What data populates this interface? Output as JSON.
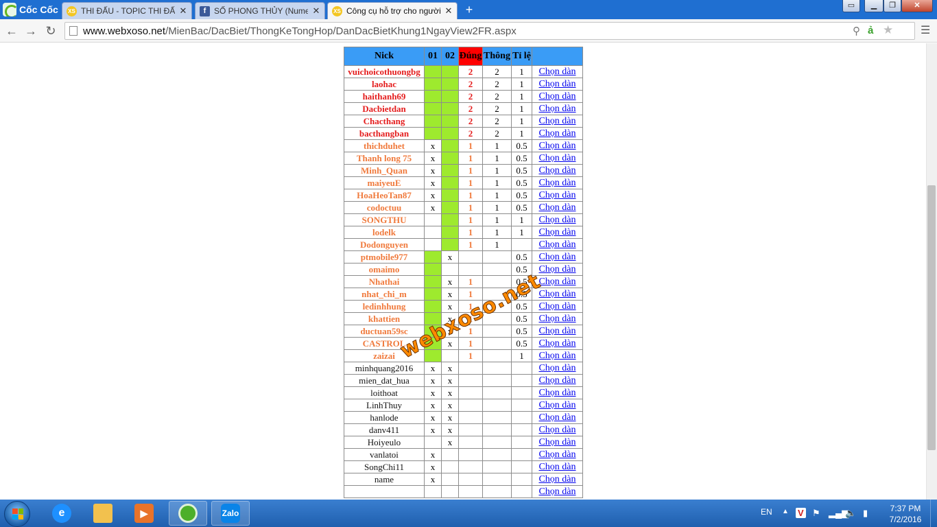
{
  "browser": {
    "brand": "Cốc Cốc",
    "tabs": [
      {
        "title": "THI ĐẤU - TOPIC THI ĐẤU",
        "icon": "xs-icon"
      },
      {
        "title": "SỐ PHONG THỦY (Numero",
        "icon": "facebook-icon"
      },
      {
        "title": "Công cụ hỗ trợ cho người",
        "icon": "xs-icon",
        "active": true
      }
    ],
    "url_host": "www.webxoso.net",
    "url_path": "/MienBac/DacBiet/ThongKeTongHop/DanDacBietKhung1NgayView2FR.aspx"
  },
  "table": {
    "headers": {
      "nick": "Nick",
      "c01": "01",
      "c02": "02",
      "dung": "Đúng",
      "thong": "Thông",
      "tile": "Tỉ lệ",
      "link": ""
    },
    "rows": [
      {
        "nick": "vuichoicothuongbg",
        "c01": "",
        "c02": "",
        "g01": true,
        "g02": true,
        "dung": "2",
        "thong": "2",
        "tile": "1",
        "link": "Chọn dàn",
        "level": 2
      },
      {
        "nick": "laohac",
        "c01": "",
        "c02": "",
        "g01": true,
        "g02": true,
        "dung": "2",
        "thong": "2",
        "tile": "1",
        "link": "Chọn dàn",
        "level": 2
      },
      {
        "nick": "haithanh69",
        "c01": "",
        "c02": "",
        "g01": true,
        "g02": true,
        "dung": "2",
        "thong": "2",
        "tile": "1",
        "link": "Chọn dàn",
        "level": 2
      },
      {
        "nick": "Dacbietdan",
        "c01": "",
        "c02": "",
        "g01": true,
        "g02": true,
        "dung": "2",
        "thong": "2",
        "tile": "1",
        "link": "Chọn dàn",
        "level": 2
      },
      {
        "nick": "Chacthang",
        "c01": "",
        "c02": "",
        "g01": true,
        "g02": true,
        "dung": "2",
        "thong": "2",
        "tile": "1",
        "link": "Chọn dàn",
        "level": 2
      },
      {
        "nick": "bacthangban",
        "c01": "",
        "c02": "",
        "g01": true,
        "g02": true,
        "dung": "2",
        "thong": "2",
        "tile": "1",
        "link": "Chọn dàn",
        "level": 2
      },
      {
        "nick": "thichduhet",
        "c01": "x",
        "c02": "",
        "g01": false,
        "g02": true,
        "dung": "1",
        "thong": "1",
        "tile": "0.5",
        "link": "Chọn dàn",
        "level": 1
      },
      {
        "nick": "Thanh long 75",
        "c01": "x",
        "c02": "",
        "g01": false,
        "g02": true,
        "dung": "1",
        "thong": "1",
        "tile": "0.5",
        "link": "Chọn dàn",
        "level": 1
      },
      {
        "nick": "Minh_Quan",
        "c01": "x",
        "c02": "",
        "g01": false,
        "g02": true,
        "dung": "1",
        "thong": "1",
        "tile": "0.5",
        "link": "Chọn dàn",
        "level": 1
      },
      {
        "nick": "maiyeuE",
        "c01": "x",
        "c02": "",
        "g01": false,
        "g02": true,
        "dung": "1",
        "thong": "1",
        "tile": "0.5",
        "link": "Chọn dàn",
        "level": 1
      },
      {
        "nick": "HoaHeoTan87",
        "c01": "x",
        "c02": "",
        "g01": false,
        "g02": true,
        "dung": "1",
        "thong": "1",
        "tile": "0.5",
        "link": "Chọn dàn",
        "level": 1
      },
      {
        "nick": "codoctuu",
        "c01": "x",
        "c02": "",
        "g01": false,
        "g02": true,
        "dung": "1",
        "thong": "1",
        "tile": "0.5",
        "link": "Chọn dàn",
        "level": 1
      },
      {
        "nick": "SONGTHU",
        "c01": "",
        "c02": "",
        "g01": false,
        "g02": true,
        "dung": "1",
        "thong": "1",
        "tile": "1",
        "link": "Chọn dàn",
        "level": 1
      },
      {
        "nick": "lodelk",
        "c01": "",
        "c02": "",
        "g01": false,
        "g02": true,
        "dung": "1",
        "thong": "1",
        "tile": "1",
        "link": "Chọn dàn",
        "level": 1
      },
      {
        "nick": "Dodonguyen",
        "c01": "",
        "c02": "",
        "g01": false,
        "g02": true,
        "dung": "1",
        "thong": "1",
        "tile": "",
        "link": "Chọn dàn",
        "level": 1
      },
      {
        "nick": "ptmobile977",
        "c01": "",
        "c02": "x",
        "g01": true,
        "g02": false,
        "dung": "",
        "thong": "",
        "tile": "0.5",
        "link": "Chọn dàn",
        "level": 1
      },
      {
        "nick": "omaimo",
        "c01": "",
        "c02": "",
        "g01": true,
        "g02": false,
        "dung": "",
        "thong": "",
        "tile": "0.5",
        "link": "Chọn dàn",
        "level": 1
      },
      {
        "nick": "Nhathai",
        "c01": "",
        "c02": "x",
        "g01": true,
        "g02": false,
        "dung": "1",
        "thong": "",
        "tile": "0.5",
        "link": "Chọn dàn",
        "level": 1
      },
      {
        "nick": "nhat_chi_m",
        "c01": "",
        "c02": "x",
        "g01": true,
        "g02": false,
        "dung": "1",
        "thong": "",
        "tile": "0.5",
        "link": "Chọn dàn",
        "level": 1
      },
      {
        "nick": "ledinhhung",
        "c01": "",
        "c02": "x",
        "g01": true,
        "g02": false,
        "dung": "1",
        "thong": "",
        "tile": "0.5",
        "link": "Chọn dàn",
        "level": 1
      },
      {
        "nick": "khattien",
        "c01": "",
        "c02": "x",
        "g01": true,
        "g02": false,
        "dung": "1",
        "thong": "",
        "tile": "0.5",
        "link": "Chọn dàn",
        "level": 1
      },
      {
        "nick": "ductuan59sc",
        "c01": "",
        "c02": "x",
        "g01": true,
        "g02": false,
        "dung": "1",
        "thong": "",
        "tile": "0.5",
        "link": "Chọn dàn",
        "level": 1
      },
      {
        "nick": "CASTROL",
        "c01": "",
        "c02": "x",
        "g01": true,
        "g02": false,
        "dung": "1",
        "thong": "",
        "tile": "0.5",
        "link": "Chọn dàn",
        "level": 1
      },
      {
        "nick": "zaizai",
        "c01": "",
        "c02": "",
        "g01": true,
        "g02": false,
        "dung": "1",
        "thong": "",
        "tile": "1",
        "link": "Chọn dàn",
        "level": 1
      },
      {
        "nick": "minhquang2016",
        "c01": "x",
        "c02": "x",
        "g01": false,
        "g02": false,
        "dung": "",
        "thong": "",
        "tile": "",
        "link": "Chọn dàn",
        "level": 0
      },
      {
        "nick": "mien_dat_hua",
        "c01": "x",
        "c02": "x",
        "g01": false,
        "g02": false,
        "dung": "",
        "thong": "",
        "tile": "",
        "link": "Chọn dàn",
        "level": 0
      },
      {
        "nick": "loithoat",
        "c01": "x",
        "c02": "x",
        "g01": false,
        "g02": false,
        "dung": "",
        "thong": "",
        "tile": "",
        "link": "Chọn dàn",
        "level": 0
      },
      {
        "nick": "LinhThuy",
        "c01": "x",
        "c02": "x",
        "g01": false,
        "g02": false,
        "dung": "",
        "thong": "",
        "tile": "",
        "link": "Chọn dàn",
        "level": 0
      },
      {
        "nick": "hanlode",
        "c01": "x",
        "c02": "x",
        "g01": false,
        "g02": false,
        "dung": "",
        "thong": "",
        "tile": "",
        "link": "Chọn dàn",
        "level": 0
      },
      {
        "nick": "danv411",
        "c01": "x",
        "c02": "x",
        "g01": false,
        "g02": false,
        "dung": "",
        "thong": "",
        "tile": "",
        "link": "Chọn dàn",
        "level": 0
      },
      {
        "nick": "Hoiyeulo",
        "c01": "",
        "c02": "x",
        "g01": false,
        "g02": false,
        "dung": "",
        "thong": "",
        "tile": "",
        "link": "Chọn dàn",
        "level": 0
      },
      {
        "nick": "vanlatoi",
        "c01": "x",
        "c02": "",
        "g01": false,
        "g02": false,
        "dung": "",
        "thong": "",
        "tile": "",
        "link": "Chọn dàn",
        "level": 0
      },
      {
        "nick": "SongChi11",
        "c01": "x",
        "c02": "",
        "g01": false,
        "g02": false,
        "dung": "",
        "thong": "",
        "tile": "",
        "link": "Chọn dàn",
        "level": 0
      },
      {
        "nick": "name",
        "c01": "x",
        "c02": "",
        "g01": false,
        "g02": false,
        "dung": "",
        "thong": "",
        "tile": "",
        "link": "Chọn dàn",
        "level": 0
      },
      {
        "nick": "",
        "c01": "",
        "c02": "",
        "g01": false,
        "g02": false,
        "dung": "",
        "thong": "",
        "tile": "",
        "link": "Chọn dàn",
        "level": 0
      }
    ]
  },
  "watermark": "webxoso.net",
  "colors": {
    "header_blue": "#3a9cf6",
    "header_red": "#ff0000",
    "hit_green": "#9eea2e",
    "level2_red": "#e41c1c",
    "level1_orange": "#f07a3c"
  },
  "taskbar": {
    "apps": [
      "internet-explorer-icon",
      "file-explorer-icon",
      "media-player-icon",
      "coccoc-browser-icon",
      "zalo-icon"
    ],
    "zalo_label": "Zalo",
    "language": "EN",
    "time": "7:37 PM",
    "date": "7/2/2016"
  }
}
